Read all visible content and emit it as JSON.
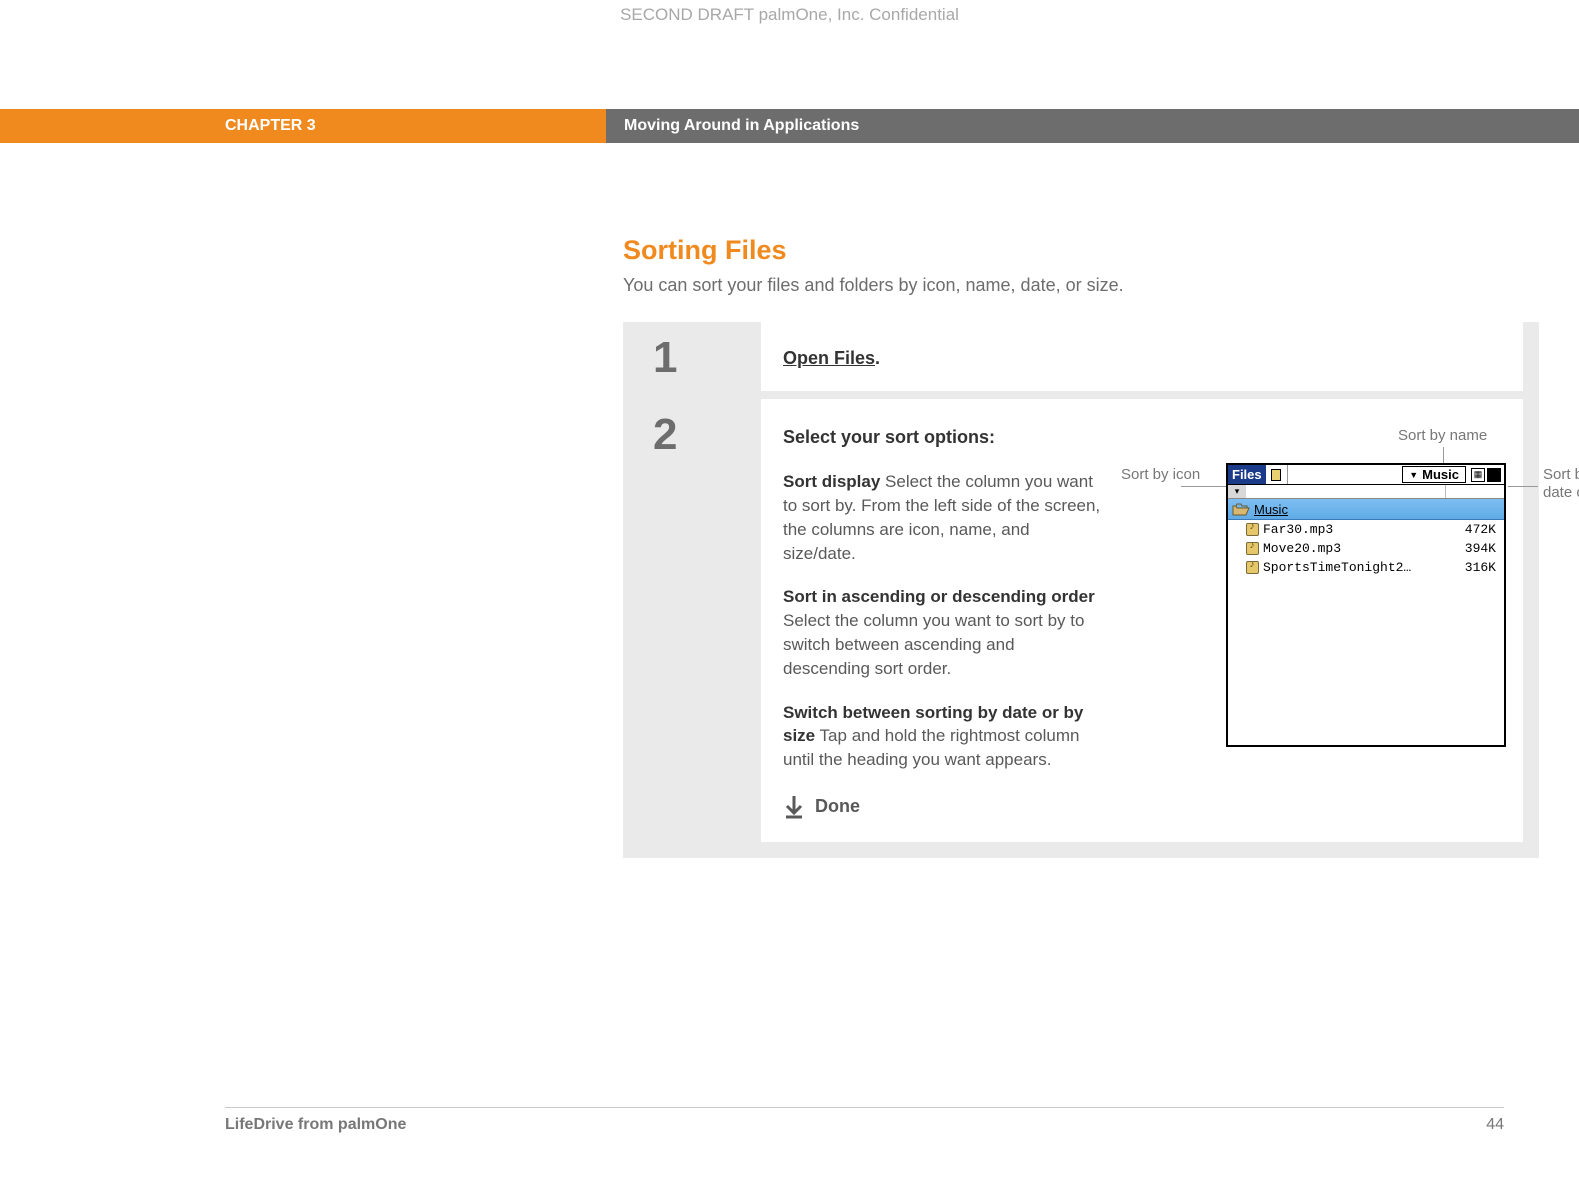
{
  "watermark": "SECOND DRAFT palmOne, Inc.  Confidential",
  "chapter_label": "CHAPTER 3",
  "chapter_title": "Moving Around in Applications",
  "section_title": "Sorting Files",
  "section_desc": "You can sort your files and folders by icon, name, date, or size.",
  "step1": {
    "num": "1",
    "link_text": "Open Files",
    "dot": "."
  },
  "step2": {
    "num": "2",
    "heading": "Select your sort options:",
    "p1_bold": "Sort display",
    "p1_rest": "   Select the column you want to sort by. From the left side of the screen, the columns are icon, name, and size/date.",
    "p2_bold": "Sort in ascending or descending order",
    "p2_rest": "   Select the column you want to sort by to switch between ascending and descending sort order.",
    "p3_bold": "Switch between sorting by date or by size",
    "p3_rest": "   Tap and hold the rightmost column until the heading you want appears.",
    "done": "Done"
  },
  "callouts": {
    "by_name": "Sort by name",
    "by_icon": "Sort by icon",
    "by_date": "Sort by date or size"
  },
  "device": {
    "app_tab": "Files",
    "dropdown": "Music",
    "breadcrumb": "Music",
    "files": [
      {
        "name": "Far30.mp3",
        "size": "472K"
      },
      {
        "name": "Move20.mp3",
        "size": "394K"
      },
      {
        "name": "SportsTimeTonight2…",
        "size": "316K"
      }
    ]
  },
  "footer": {
    "product": "LifeDrive from palmOne",
    "page": "44"
  }
}
